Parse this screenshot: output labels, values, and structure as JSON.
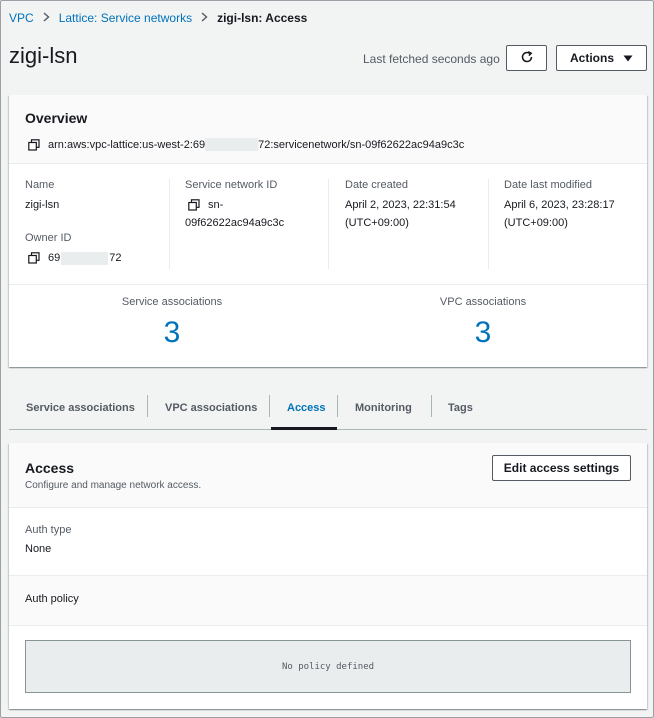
{
  "breadcrumb": {
    "items": [
      "VPC",
      "Lattice: Service networks"
    ],
    "current": "zigi-lsn: Access"
  },
  "header": {
    "title": "zigi-lsn",
    "last_fetched": "Last fetched seconds ago",
    "actions_label": "Actions"
  },
  "overview": {
    "title": "Overview",
    "arn_prefix": "arn:aws:vpc-lattice:us-west-2:69",
    "arn_suffix": "72:servicenetwork/sn-09f62622ac94a9c3c",
    "name_label": "Name",
    "name_value": "zigi-lsn",
    "owner_label": "Owner ID",
    "owner_prefix": "69",
    "owner_suffix": "72",
    "sn_id_label": "Service network ID",
    "sn_id_value_1": "sn-",
    "sn_id_value_2": "09f62622ac94a9c3c",
    "created_label": "Date created",
    "created_value_1": "April 2, 2023, 22:31:54",
    "created_value_2": "(UTC+09:00)",
    "modified_label": "Date last modified",
    "modified_value_1": "April 6, 2023, 23:28:17",
    "modified_value_2": "(UTC+09:00)",
    "service_assoc_label": "Service associations",
    "service_assoc_value": "3",
    "vpc_assoc_label": "VPC associations",
    "vpc_assoc_value": "3"
  },
  "tabs": [
    {
      "label": "Service associations"
    },
    {
      "label": "VPC associations"
    },
    {
      "label": "Access"
    },
    {
      "label": "Monitoring"
    },
    {
      "label": "Tags"
    }
  ],
  "access": {
    "title": "Access",
    "description": "Configure and manage network access.",
    "edit_label": "Edit access settings",
    "auth_type_label": "Auth type",
    "auth_type_value": "None",
    "auth_policy_label": "Auth policy",
    "policy_text": "No policy defined"
  },
  "colors": {
    "link": "#0073bb",
    "text": "#16191f",
    "muted": "#545b64",
    "background": "#f2f3f3"
  }
}
